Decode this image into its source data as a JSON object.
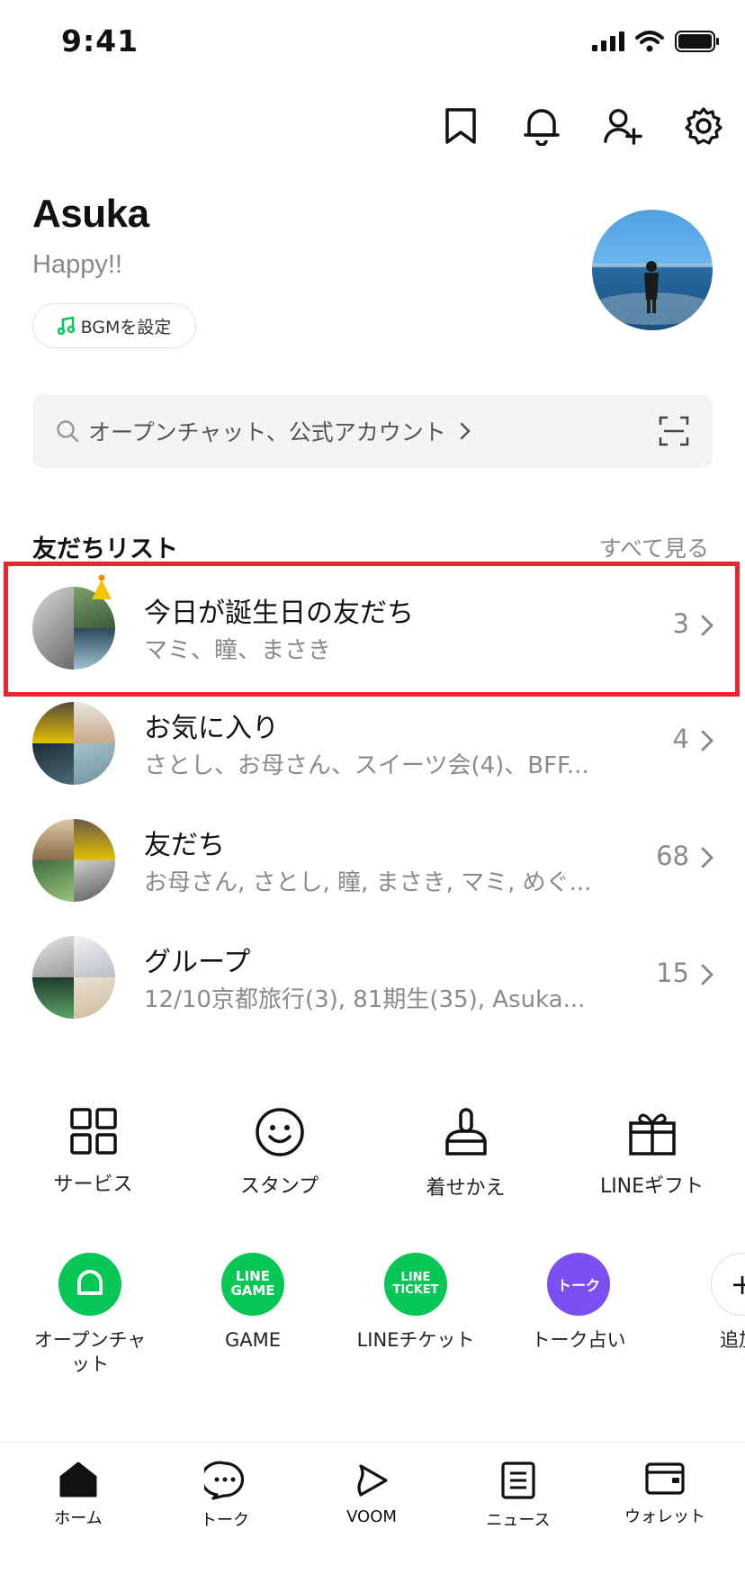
{
  "status_bar": {
    "time": "9:41"
  },
  "profile": {
    "name": "Asuka",
    "status_message": "Happy!!",
    "bgm_label": "BGMを設定"
  },
  "search": {
    "placeholder": "オープンチャット、公式アカウント"
  },
  "friends_section": {
    "title": "友だちリスト",
    "see_all": "すべて見る"
  },
  "friend_rows": [
    {
      "title": "今日が誕生日の友だち",
      "subtitle": "マミ、瞳、まさき",
      "count": "3"
    },
    {
      "title": "お気に入り",
      "subtitle": "さとし、お母さん、スイーツ会(4)、BFF...",
      "count": "4"
    },
    {
      "title": "友だち",
      "subtitle": "お母さん, さとし, 瞳,  まさき, マミ,  めぐ...",
      "count": "68"
    },
    {
      "title": "グループ",
      "subtitle": "12/10京都旅行(3), 81期生(35), Asuka...",
      "count": "15"
    }
  ],
  "services": [
    {
      "label": "サービス",
      "icon": "grid-icon"
    },
    {
      "label": "スタンプ",
      "icon": "smiley-icon"
    },
    {
      "label": "着せかえ",
      "icon": "brush-icon"
    },
    {
      "label": "LINEギフト",
      "icon": "gift-icon"
    }
  ],
  "apps": [
    {
      "label": "オープンチャット",
      "icon_text": "",
      "color": "#06c755"
    },
    {
      "label": "GAME",
      "icon_text": "LINE GAME",
      "color": "#06c755"
    },
    {
      "label": "LINEチケット",
      "icon_text": "LINE TICKET",
      "color": "#06c755"
    },
    {
      "label": "トーク占い",
      "icon_text": "トーク",
      "color": "#7b4ff0"
    },
    {
      "label": "追加",
      "icon_text": "+",
      "color": "#ffffff"
    }
  ],
  "tabs": [
    {
      "label": "ホーム",
      "icon": "home-icon"
    },
    {
      "label": "トーク",
      "icon": "chat-icon"
    },
    {
      "label": "VOOM",
      "icon": "voom-icon"
    },
    {
      "label": "ニュース",
      "icon": "news-icon"
    },
    {
      "label": "ウォレット",
      "icon": "wallet-icon"
    }
  ],
  "colors": {
    "accent_green": "#06c755",
    "highlight_red": "#e8262e",
    "text_gray": "#8a8a8a"
  }
}
